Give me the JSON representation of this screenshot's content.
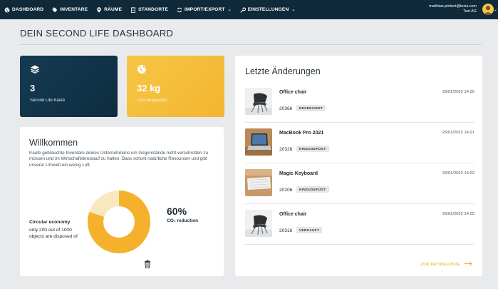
{
  "nav": {
    "items": [
      {
        "label": "DASHBOARD",
        "icon": "globe-icon"
      },
      {
        "label": "INVENTARE",
        "icon": "tag-icon"
      },
      {
        "label": "RÄUME",
        "icon": "pin-icon"
      },
      {
        "label": "STANDORTE",
        "icon": "building-icon"
      },
      {
        "label": "IMPORT/EXPORT",
        "icon": "sync-icon",
        "has_dropdown": true
      },
      {
        "label": "EINSTELLUNGEN",
        "icon": "wrench-icon",
        "has_dropdown": true
      }
    ],
    "account": {
      "email": "matthias.pinkert@texia.com",
      "company": "Test AG"
    }
  },
  "page": {
    "title": "DEIN SECOND LIFE DASHBOARD"
  },
  "stats": [
    {
      "value": "3",
      "label": "Second Life Käufe",
      "icon": "layers-icon",
      "color": "#12364c"
    },
    {
      "value": "32 kg",
      "label": "CO2 eingespart",
      "icon": "globe-icon",
      "color": "#f5bd3a"
    }
  ],
  "welcome": {
    "title": "Willkommen",
    "intro": "Kaufe gebrauchte Inventare deines Unternehmens um Gegenstände nicht verschrotten zu müssen und im Wirtschaftskreislauf zu halten. Dass schont natürliche Resourcen und gibt unserer Umwelt ein wenig Luft.",
    "circular_title": "Circular economy",
    "circular_text": "only 200 out of 1000 objects are disposed of",
    "percent": "60%",
    "percent_label": "CO₂ reduction",
    "donut_fraction": 0.8
  },
  "changes": {
    "title": "Letzte Änderungen",
    "items": [
      {
        "name": "Office chair",
        "number": "20366",
        "status": "RESERVIERT",
        "date": "25/01/2022 14:20",
        "thumb": "chair"
      },
      {
        "name": "MacBook Pro 2021",
        "number": "20326",
        "status": "HINZUGEFÜGT",
        "date": "25/01/2022 14:21",
        "thumb": "laptop"
      },
      {
        "name": "Magic Keyboard",
        "number": "20206",
        "status": "HINZUGEFÜGT",
        "date": "25/01/2022 14:22",
        "thumb": "keyboard"
      },
      {
        "name": "Office chair",
        "number": "20316",
        "status": "VERKAUFT",
        "date": "25/01/2022 14:25",
        "thumb": "chair"
      }
    ],
    "footer_link": "ZUR ARTIKELLISTE"
  }
}
